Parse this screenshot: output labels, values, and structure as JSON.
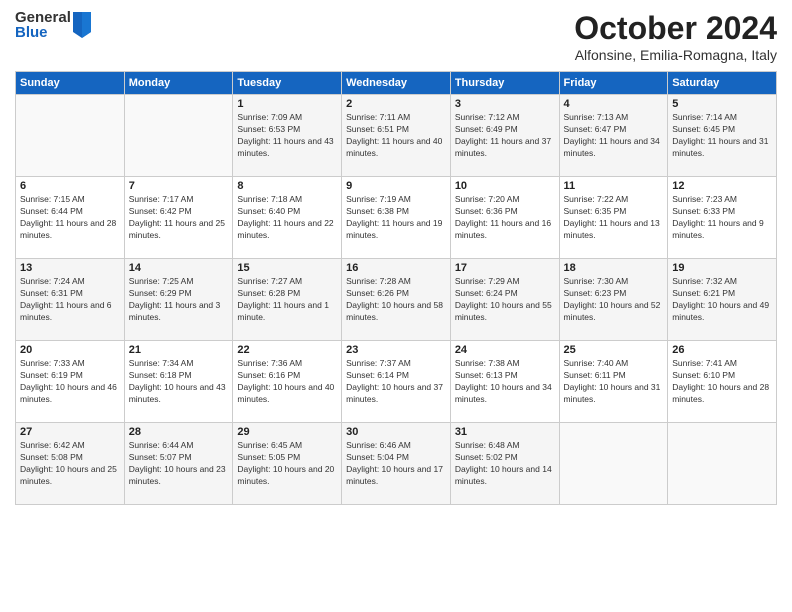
{
  "logo": {
    "general": "General",
    "blue": "Blue"
  },
  "title": "October 2024",
  "location": "Alfonsine, Emilia-Romagna, Italy",
  "days_of_week": [
    "Sunday",
    "Monday",
    "Tuesday",
    "Wednesday",
    "Thursday",
    "Friday",
    "Saturday"
  ],
  "weeks": [
    [
      {
        "day": "",
        "sunrise": "",
        "sunset": "",
        "daylight": ""
      },
      {
        "day": "",
        "sunrise": "",
        "sunset": "",
        "daylight": ""
      },
      {
        "day": "1",
        "sunrise": "Sunrise: 7:09 AM",
        "sunset": "Sunset: 6:53 PM",
        "daylight": "Daylight: 11 hours and 43 minutes."
      },
      {
        "day": "2",
        "sunrise": "Sunrise: 7:11 AM",
        "sunset": "Sunset: 6:51 PM",
        "daylight": "Daylight: 11 hours and 40 minutes."
      },
      {
        "day": "3",
        "sunrise": "Sunrise: 7:12 AM",
        "sunset": "Sunset: 6:49 PM",
        "daylight": "Daylight: 11 hours and 37 minutes."
      },
      {
        "day": "4",
        "sunrise": "Sunrise: 7:13 AM",
        "sunset": "Sunset: 6:47 PM",
        "daylight": "Daylight: 11 hours and 34 minutes."
      },
      {
        "day": "5",
        "sunrise": "Sunrise: 7:14 AM",
        "sunset": "Sunset: 6:45 PM",
        "daylight": "Daylight: 11 hours and 31 minutes."
      }
    ],
    [
      {
        "day": "6",
        "sunrise": "Sunrise: 7:15 AM",
        "sunset": "Sunset: 6:44 PM",
        "daylight": "Daylight: 11 hours and 28 minutes."
      },
      {
        "day": "7",
        "sunrise": "Sunrise: 7:17 AM",
        "sunset": "Sunset: 6:42 PM",
        "daylight": "Daylight: 11 hours and 25 minutes."
      },
      {
        "day": "8",
        "sunrise": "Sunrise: 7:18 AM",
        "sunset": "Sunset: 6:40 PM",
        "daylight": "Daylight: 11 hours and 22 minutes."
      },
      {
        "day": "9",
        "sunrise": "Sunrise: 7:19 AM",
        "sunset": "Sunset: 6:38 PM",
        "daylight": "Daylight: 11 hours and 19 minutes."
      },
      {
        "day": "10",
        "sunrise": "Sunrise: 7:20 AM",
        "sunset": "Sunset: 6:36 PM",
        "daylight": "Daylight: 11 hours and 16 minutes."
      },
      {
        "day": "11",
        "sunrise": "Sunrise: 7:22 AM",
        "sunset": "Sunset: 6:35 PM",
        "daylight": "Daylight: 11 hours and 13 minutes."
      },
      {
        "day": "12",
        "sunrise": "Sunrise: 7:23 AM",
        "sunset": "Sunset: 6:33 PM",
        "daylight": "Daylight: 11 hours and 9 minutes."
      }
    ],
    [
      {
        "day": "13",
        "sunrise": "Sunrise: 7:24 AM",
        "sunset": "Sunset: 6:31 PM",
        "daylight": "Daylight: 11 hours and 6 minutes."
      },
      {
        "day": "14",
        "sunrise": "Sunrise: 7:25 AM",
        "sunset": "Sunset: 6:29 PM",
        "daylight": "Daylight: 11 hours and 3 minutes."
      },
      {
        "day": "15",
        "sunrise": "Sunrise: 7:27 AM",
        "sunset": "Sunset: 6:28 PM",
        "daylight": "Daylight: 11 hours and 1 minute."
      },
      {
        "day": "16",
        "sunrise": "Sunrise: 7:28 AM",
        "sunset": "Sunset: 6:26 PM",
        "daylight": "Daylight: 10 hours and 58 minutes."
      },
      {
        "day": "17",
        "sunrise": "Sunrise: 7:29 AM",
        "sunset": "Sunset: 6:24 PM",
        "daylight": "Daylight: 10 hours and 55 minutes."
      },
      {
        "day": "18",
        "sunrise": "Sunrise: 7:30 AM",
        "sunset": "Sunset: 6:23 PM",
        "daylight": "Daylight: 10 hours and 52 minutes."
      },
      {
        "day": "19",
        "sunrise": "Sunrise: 7:32 AM",
        "sunset": "Sunset: 6:21 PM",
        "daylight": "Daylight: 10 hours and 49 minutes."
      }
    ],
    [
      {
        "day": "20",
        "sunrise": "Sunrise: 7:33 AM",
        "sunset": "Sunset: 6:19 PM",
        "daylight": "Daylight: 10 hours and 46 minutes."
      },
      {
        "day": "21",
        "sunrise": "Sunrise: 7:34 AM",
        "sunset": "Sunset: 6:18 PM",
        "daylight": "Daylight: 10 hours and 43 minutes."
      },
      {
        "day": "22",
        "sunrise": "Sunrise: 7:36 AM",
        "sunset": "Sunset: 6:16 PM",
        "daylight": "Daylight: 10 hours and 40 minutes."
      },
      {
        "day": "23",
        "sunrise": "Sunrise: 7:37 AM",
        "sunset": "Sunset: 6:14 PM",
        "daylight": "Daylight: 10 hours and 37 minutes."
      },
      {
        "day": "24",
        "sunrise": "Sunrise: 7:38 AM",
        "sunset": "Sunset: 6:13 PM",
        "daylight": "Daylight: 10 hours and 34 minutes."
      },
      {
        "day": "25",
        "sunrise": "Sunrise: 7:40 AM",
        "sunset": "Sunset: 6:11 PM",
        "daylight": "Daylight: 10 hours and 31 minutes."
      },
      {
        "day": "26",
        "sunrise": "Sunrise: 7:41 AM",
        "sunset": "Sunset: 6:10 PM",
        "daylight": "Daylight: 10 hours and 28 minutes."
      }
    ],
    [
      {
        "day": "27",
        "sunrise": "Sunrise: 6:42 AM",
        "sunset": "Sunset: 5:08 PM",
        "daylight": "Daylight: 10 hours and 25 minutes."
      },
      {
        "day": "28",
        "sunrise": "Sunrise: 6:44 AM",
        "sunset": "Sunset: 5:07 PM",
        "daylight": "Daylight: 10 hours and 23 minutes."
      },
      {
        "day": "29",
        "sunrise": "Sunrise: 6:45 AM",
        "sunset": "Sunset: 5:05 PM",
        "daylight": "Daylight: 10 hours and 20 minutes."
      },
      {
        "day": "30",
        "sunrise": "Sunrise: 6:46 AM",
        "sunset": "Sunset: 5:04 PM",
        "daylight": "Daylight: 10 hours and 17 minutes."
      },
      {
        "day": "31",
        "sunrise": "Sunrise: 6:48 AM",
        "sunset": "Sunset: 5:02 PM",
        "daylight": "Daylight: 10 hours and 14 minutes."
      },
      {
        "day": "",
        "sunrise": "",
        "sunset": "",
        "daylight": ""
      },
      {
        "day": "",
        "sunrise": "",
        "sunset": "",
        "daylight": ""
      }
    ]
  ]
}
